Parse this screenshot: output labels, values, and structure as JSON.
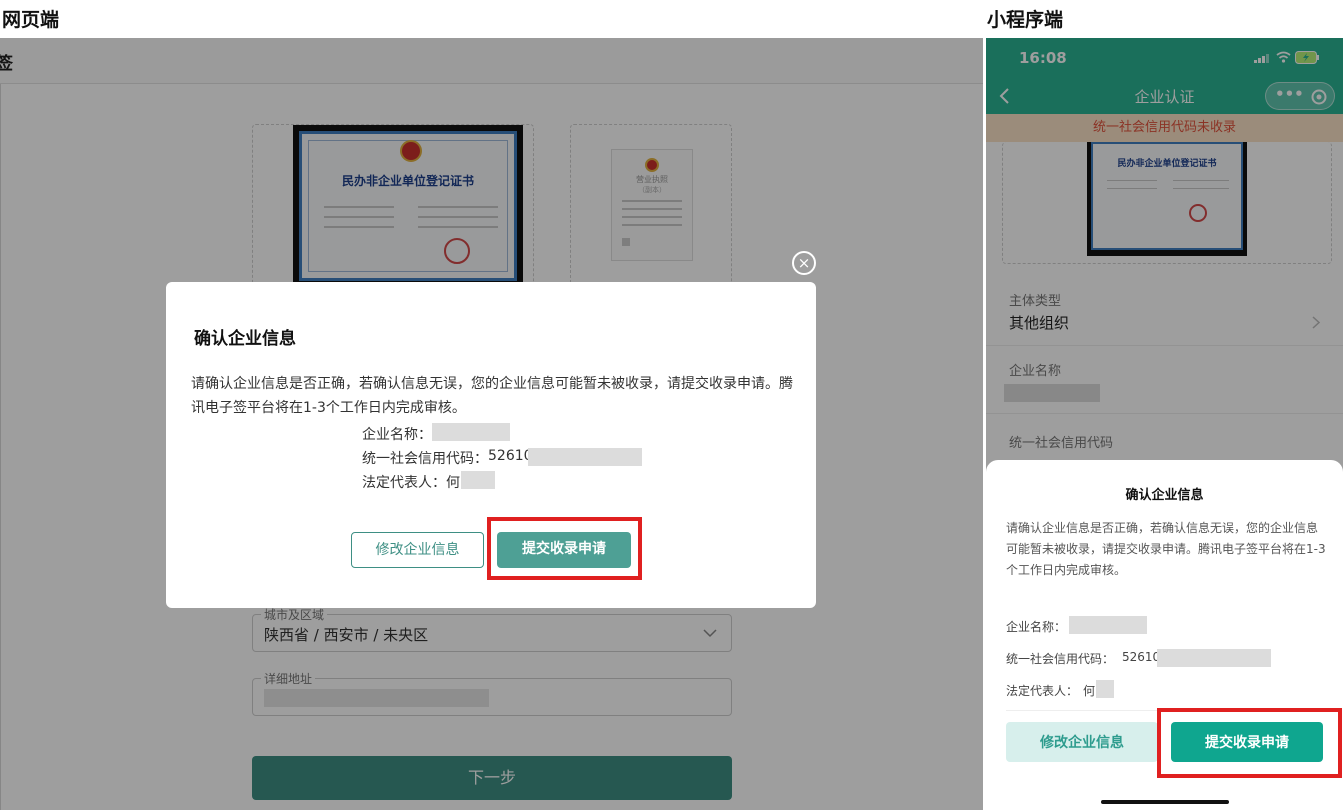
{
  "labels": {
    "web_section": "网页端",
    "mini_section": "小程序端"
  },
  "web": {
    "topbar_title": "签",
    "cert_title": "民办非企业单位登记证书",
    "license_title": "营业执照",
    "license_sub": "（副本）",
    "city_label": "城市及区域",
    "city_value": "陕西省 / 西安市 / 未央区",
    "address_label": "详细地址",
    "next_button": "下一步",
    "dialog": {
      "close": "×",
      "title": "确认企业信息",
      "message": "请确认企业信息是否正确，若确认信息无误，您的企业信息可能暂未被收录，请提交收录申请。腾讯电子签平台将在1-3个工作日内完成审核。",
      "company_name_label": "企业名称：",
      "credit_code_label": "统一社会信用代码：",
      "credit_code_prefix": "52610",
      "legal_rep_label": "法定代表人：",
      "legal_rep_prefix": "何",
      "modify_button": "修改企业信息",
      "submit_button": "提交收录申请"
    }
  },
  "mini": {
    "time": "16:08",
    "nav_title": "企业认证",
    "back_icon": "chevron-left",
    "warning": "统一社会信用代码未收录",
    "cert_title": "民办非企业单位登记证书",
    "subject_type_label": "主体类型",
    "subject_type_value": "其他组织",
    "company_name_label": "企业名称",
    "credit_code_label": "统一社会信用代码",
    "sheet": {
      "title": "确认企业信息",
      "message": "请确认企业信息是否正确，若确认信息无误，您的企业信息可能暂未被收录，请提交收录申请。腾讯电子签平台将在1-3个工作日内完成审核。",
      "company_name_label": "企业名称：",
      "credit_code_label": "统一社会信用代码：",
      "credit_code_prefix": "52610",
      "legal_rep_label": "法定代表人：",
      "legal_rep_prefix": "何",
      "modify_button": "修改企业信息",
      "submit_button": "提交收录申请"
    }
  },
  "colors": {
    "accent": "#4ea095",
    "mini_accent": "#2bb394",
    "highlight": "#e02020"
  }
}
